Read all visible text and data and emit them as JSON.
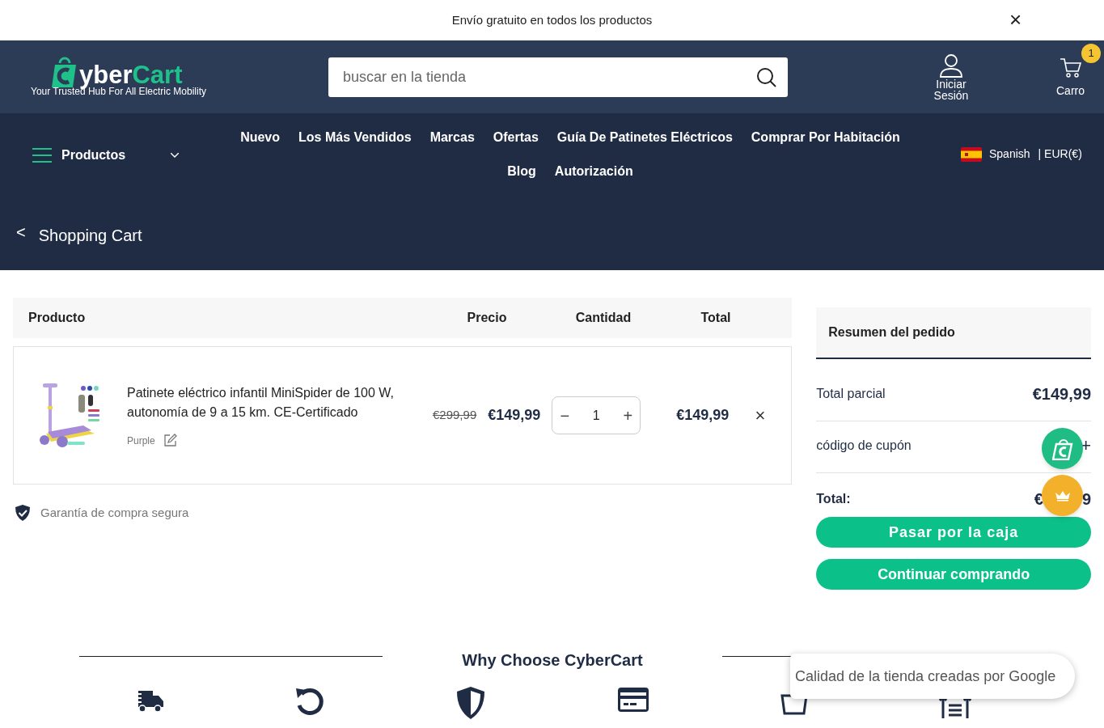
{
  "announcement": {
    "text": "Envío gratuito en todos los productos",
    "close": "×"
  },
  "header": {
    "logo": {
      "first": "yber",
      "second": "Cart",
      "tagline": "Your Trusted Hub For All Electric Mobility"
    },
    "search": {
      "placeholder": "buscar en la tienda"
    },
    "account": "Iniciar Sesión",
    "cart": {
      "label": "Carro",
      "count": "1"
    }
  },
  "nav": {
    "products": "Productos",
    "links": [
      {
        "label": "Nuevo"
      },
      {
        "label": "Los Más Vendidos"
      },
      {
        "label": "Marcas"
      },
      {
        "label": "Ofertas"
      },
      {
        "label": "Guía De Patinetes Eléctricos"
      },
      {
        "label": "Comprar Por Habitación"
      },
      {
        "label": "Blog"
      },
      {
        "label": "Autorización"
      }
    ],
    "language": "Spanish",
    "currency": "| EUR(€)"
  },
  "page_title": {
    "back": "<",
    "title": "Shopping Cart"
  },
  "cart_table": {
    "columns": [
      "Producto",
      "Precio",
      "Cantidad",
      "Total"
    ],
    "rows": [
      {
        "kind": "picture",
        "name": "Patinete eléctrico infantil MiniSpider de 100 W, autonomía de 9 a 15 km. CE-Certificado",
        "variant": "Purple",
        "old_price": "€299,99",
        "price": "€149,99",
        "quantity": "1",
        "minus": "−",
        "plus": "+",
        "total": "€149,99",
        "remove": "×"
      }
    ]
  },
  "guarantee": "Garantía de compra segura",
  "summary": {
    "title": "Resumen del pedido",
    "subtotal_label": "Total parcial",
    "subtotal": "€149,99",
    "coupon_label": "código de cupón",
    "coupon_toggle": "+",
    "total_label": "Total:",
    "total_visible": [
      "€",
      "9"
    ],
    "buttons": [
      "Pasar por la caja",
      "Continuar comprando"
    ]
  },
  "why": {
    "title": "Why Choose CyberCart"
  },
  "google_badge": "Calidad de la tienda creadas por Google"
}
